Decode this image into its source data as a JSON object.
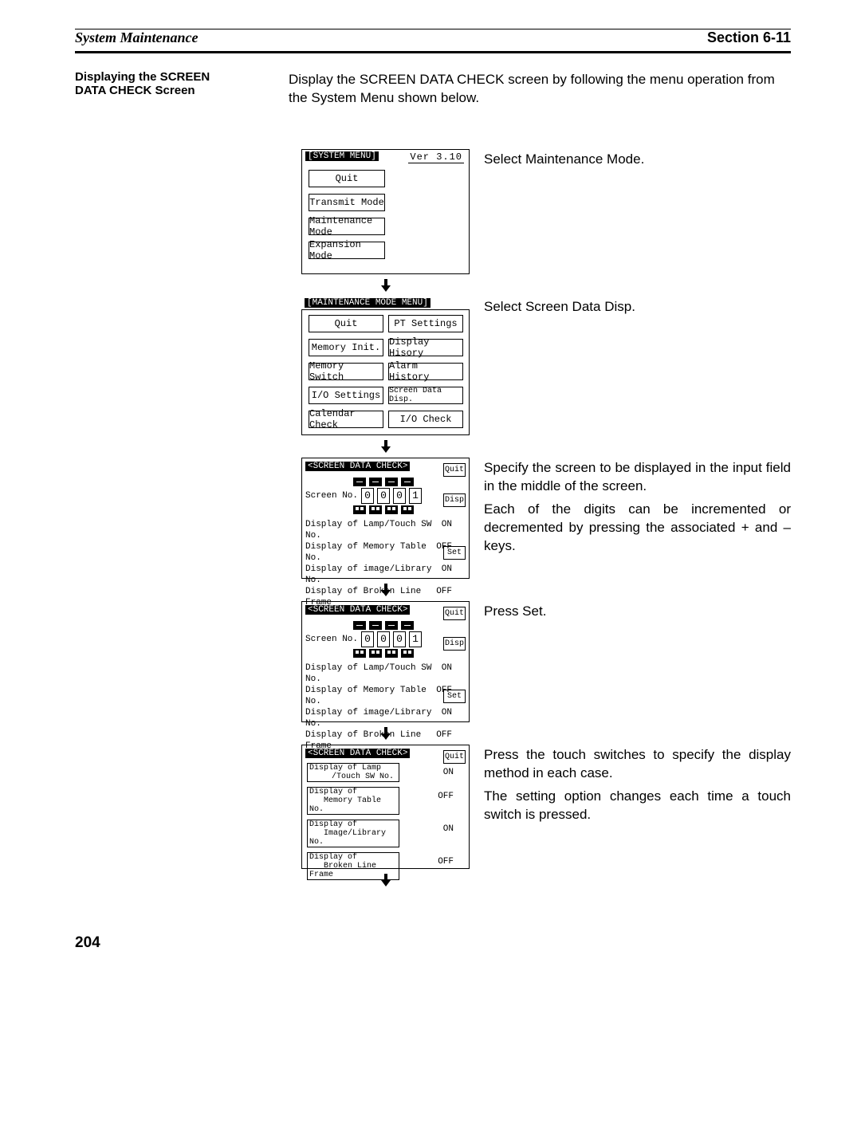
{
  "header": {
    "left": "System Maintenance",
    "right": "Section  6-11"
  },
  "sidehead": {
    "l1": "Displaying the SCREEN",
    "l2": "DATA CHECK Screen"
  },
  "intro": "Display the SCREEN DATA CHECK screen by following the menu operation from the System Menu shown below.",
  "panel1": {
    "title": "[SYSTEM MENU]",
    "version": "Ver 3.10",
    "items": [
      "Quit",
      "Transmit Mode",
      "Maintenance Mode",
      "Expansion Mode"
    ],
    "note": "Select Maintenance Mode."
  },
  "panel2": {
    "title": "[MAINTENANCE MODE MENU]",
    "left": [
      "Quit",
      "Memory Init.",
      "Memory Switch",
      "I/O Settings",
      "Calendar Check"
    ],
    "right": [
      "PT Settings",
      "Display Hisory",
      "Alarm History",
      "Screen Data Disp.",
      "I/O Check"
    ],
    "note": "Select Screen Data Disp."
  },
  "panel3": {
    "title": "<SCREEN DATA CHECK>",
    "screen_no_label": "Screen No.",
    "digits": [
      "0",
      "0",
      "0",
      "1"
    ],
    "quit": "Quit",
    "disp": "Disp",
    "set": "Set",
    "lines": [
      {
        "label": "Display of Lamp/Touch SW No.",
        "val": "ON"
      },
      {
        "label": "Display of Memory Table No.",
        "val": "OFF"
      },
      {
        "label": "Display of image/Library No.",
        "val": "ON"
      },
      {
        "label": "Display of Broken Line Frame",
        "val": "OFF"
      }
    ],
    "note1": "Specify the screen to be displayed in the input field in the middle of the screen.",
    "note2": "Each of the digits can be incremented or decremented by pressing the associated + and – keys."
  },
  "panel4": {
    "note": "Press Set."
  },
  "panel5": {
    "title": "<SCREEN DATA CHECK>",
    "quit": "Quit",
    "rows": [
      {
        "l1": "Display of Lamp",
        "l2": "/Touch SW No.",
        "val": "ON"
      },
      {
        "l1": "Display of",
        "l2": "Memory Table No.",
        "val": "OFF"
      },
      {
        "l1": "Display of",
        "l2": "Image/Library No.",
        "val": "ON"
      },
      {
        "l1": "Display of",
        "l2": "Broken Line Frame",
        "val": "OFF"
      }
    ],
    "note1": "Press the touch switches to specify the display method in each case.",
    "note2": "The setting option changes each time a touch switch is pressed."
  },
  "page_no": "204"
}
